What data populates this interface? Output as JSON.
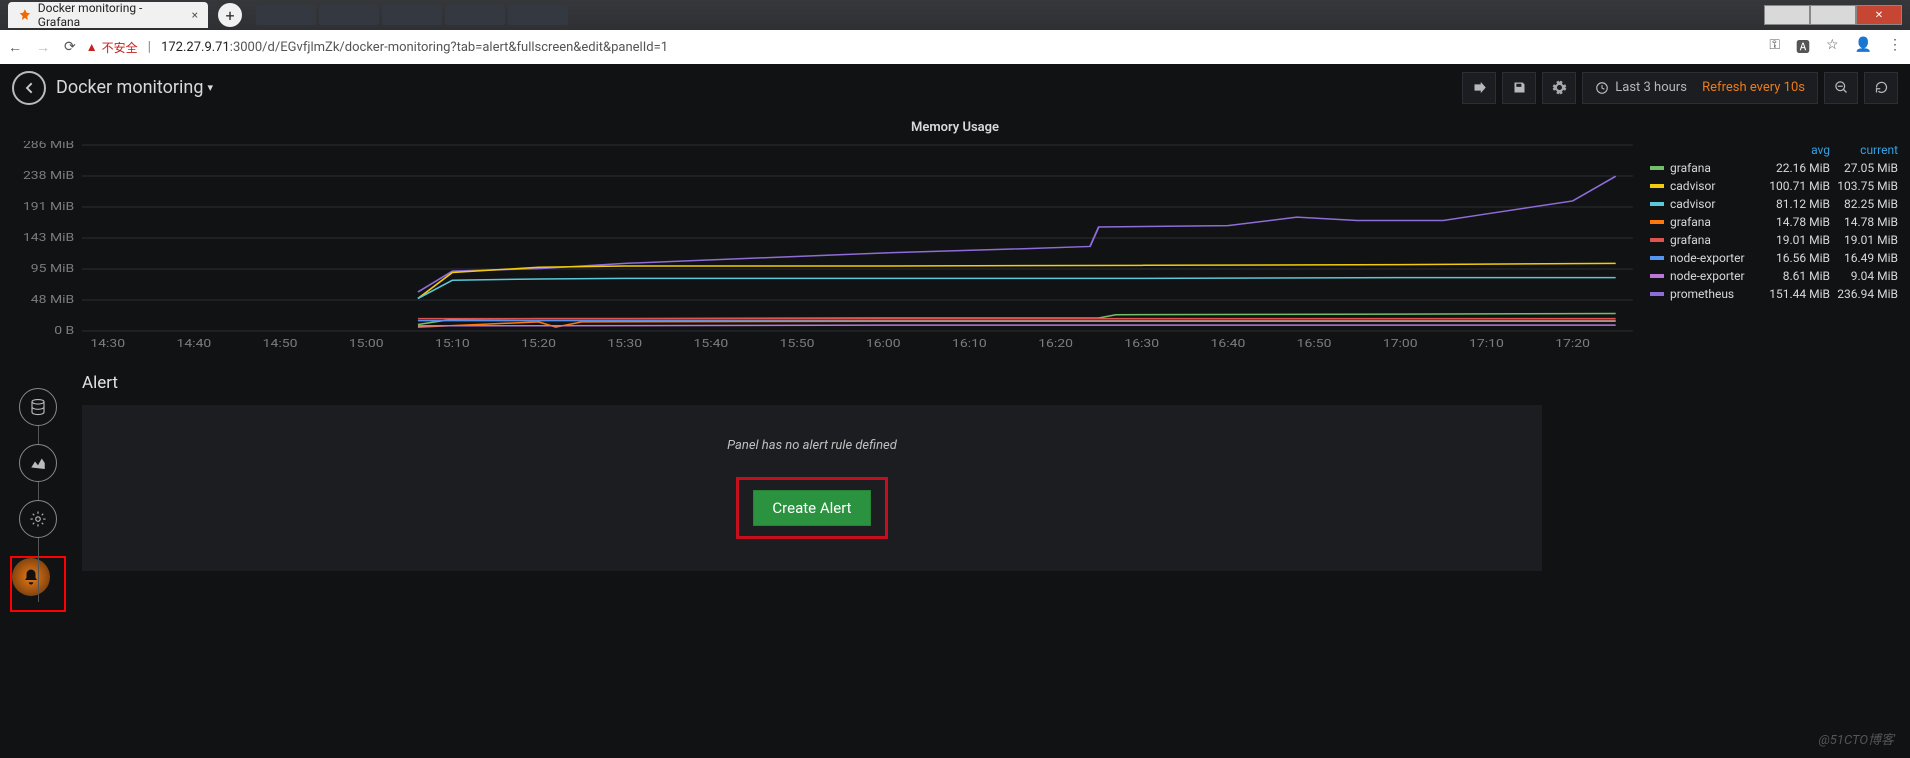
{
  "browser": {
    "tab_title": "Docker monitoring - Grafana",
    "unsafe_label": "不安全",
    "url_prefix": "172.27.9.71",
    "url_suffix": ":3000/d/EGvfjlmZk/docker-monitoring?tab=alert&fullscreen&edit&panelId=1"
  },
  "header": {
    "dashboard_title": "Docker monitoring",
    "time_label": "Last 3 hours",
    "refresh_label": "Refresh every 10s"
  },
  "panel": {
    "title": "Memory Usage",
    "legend_headers": {
      "avg": "avg",
      "current": "current"
    },
    "legend": [
      {
        "name": "grafana",
        "color": "#73bf69",
        "avg": "22.16 MiB",
        "current": "27.05 MiB"
      },
      {
        "name": "cadvisor",
        "color": "#f2cc0c",
        "avg": "100.71 MiB",
        "current": "103.75 MiB"
      },
      {
        "name": "cadvisor",
        "color": "#5ac8d8",
        "avg": "81.12 MiB",
        "current": "82.25 MiB"
      },
      {
        "name": "grafana",
        "color": "#ff780a",
        "avg": "14.78 MiB",
        "current": "14.78 MiB"
      },
      {
        "name": "grafana",
        "color": "#e0524e",
        "avg": "19.01 MiB",
        "current": "19.01 MiB"
      },
      {
        "name": "node-exporter",
        "color": "#5794f2",
        "avg": "16.56 MiB",
        "current": "16.49 MiB"
      },
      {
        "name": "node-exporter",
        "color": "#b877d9",
        "avg": "8.61 MiB",
        "current": "9.04 MiB"
      },
      {
        "name": "prometheus",
        "color": "#8f6cd8",
        "avg": "151.44 MiB",
        "current": "236.94 MiB"
      }
    ]
  },
  "chart_data": {
    "type": "line",
    "title": "Memory Usage",
    "xlabel": "",
    "ylabel": "",
    "x_ticks": [
      "14:30",
      "14:40",
      "14:50",
      "15:00",
      "15:10",
      "15:20",
      "15:30",
      "15:40",
      "15:50",
      "16:00",
      "16:10",
      "16:20",
      "16:30",
      "16:40",
      "16:50",
      "17:00",
      "17:10",
      "17:20"
    ],
    "y_ticks": [
      "0 B",
      "48 MiB",
      "95 MiB",
      "143 MiB",
      "191 MiB",
      "238 MiB",
      "286 MiB"
    ],
    "ylim": [
      0,
      286
    ],
    "xlim": [
      "14:27",
      "17:27"
    ],
    "series": [
      {
        "name": "prometheus",
        "color": "#8f6cd8",
        "x": [
          "15:06",
          "15:10",
          "15:20",
          "15:30",
          "15:45",
          "16:00",
          "16:15",
          "16:24",
          "16:25",
          "16:40",
          "16:48",
          "16:55",
          "17:05",
          "17:10",
          "17:20",
          "17:25"
        ],
        "values": [
          60,
          92,
          96,
          104,
          112,
          120,
          126,
          130,
          160,
          162,
          175,
          170,
          170,
          180,
          200,
          238
        ]
      },
      {
        "name": "cadvisor",
        "color": "#f2cc0c",
        "x": [
          "15:06",
          "15:10",
          "15:20",
          "15:30",
          "16:00",
          "16:30",
          "17:00",
          "17:25"
        ],
        "values": [
          50,
          90,
          98,
          100,
          100,
          101,
          102,
          104
        ]
      },
      {
        "name": "cadvisor",
        "color": "#5ac8d8",
        "x": [
          "15:06",
          "15:10",
          "15:20",
          "15:30",
          "16:00",
          "16:30",
          "17:00",
          "17:25"
        ],
        "values": [
          50,
          78,
          80,
          81,
          81,
          81,
          82,
          82
        ]
      },
      {
        "name": "grafana",
        "color": "#73bf69",
        "x": [
          "15:06",
          "15:10",
          "15:20",
          "15:30",
          "16:00",
          "16:25",
          "16:27",
          "17:00",
          "17:25"
        ],
        "values": [
          10,
          18,
          19,
          19,
          20,
          20,
          25,
          26,
          27
        ]
      },
      {
        "name": "grafana",
        "color": "#e0524e",
        "x": [
          "15:06",
          "15:20",
          "16:00",
          "17:00",
          "17:25"
        ],
        "values": [
          19,
          19,
          19,
          19,
          19
        ]
      },
      {
        "name": "node-exporter",
        "color": "#5794f2",
        "x": [
          "15:06",
          "15:20",
          "16:00",
          "17:00",
          "17:25"
        ],
        "values": [
          16,
          16,
          16,
          16,
          16
        ]
      },
      {
        "name": "grafana",
        "color": "#ff780a",
        "x": [
          "15:06",
          "15:20",
          "15:22",
          "15:25",
          "16:00",
          "17:00",
          "17:25"
        ],
        "values": [
          6,
          14,
          6,
          14,
          15,
          15,
          15
        ]
      },
      {
        "name": "node-exporter",
        "color": "#b877d9",
        "x": [
          "15:06",
          "15:20",
          "16:00",
          "17:00",
          "17:25"
        ],
        "values": [
          8,
          8,
          9,
          9,
          9
        ]
      }
    ]
  },
  "alert": {
    "section_title": "Alert",
    "no_rule_text": "Panel has no alert rule defined",
    "create_label": "Create Alert"
  },
  "watermark": "@51CTO博客"
}
